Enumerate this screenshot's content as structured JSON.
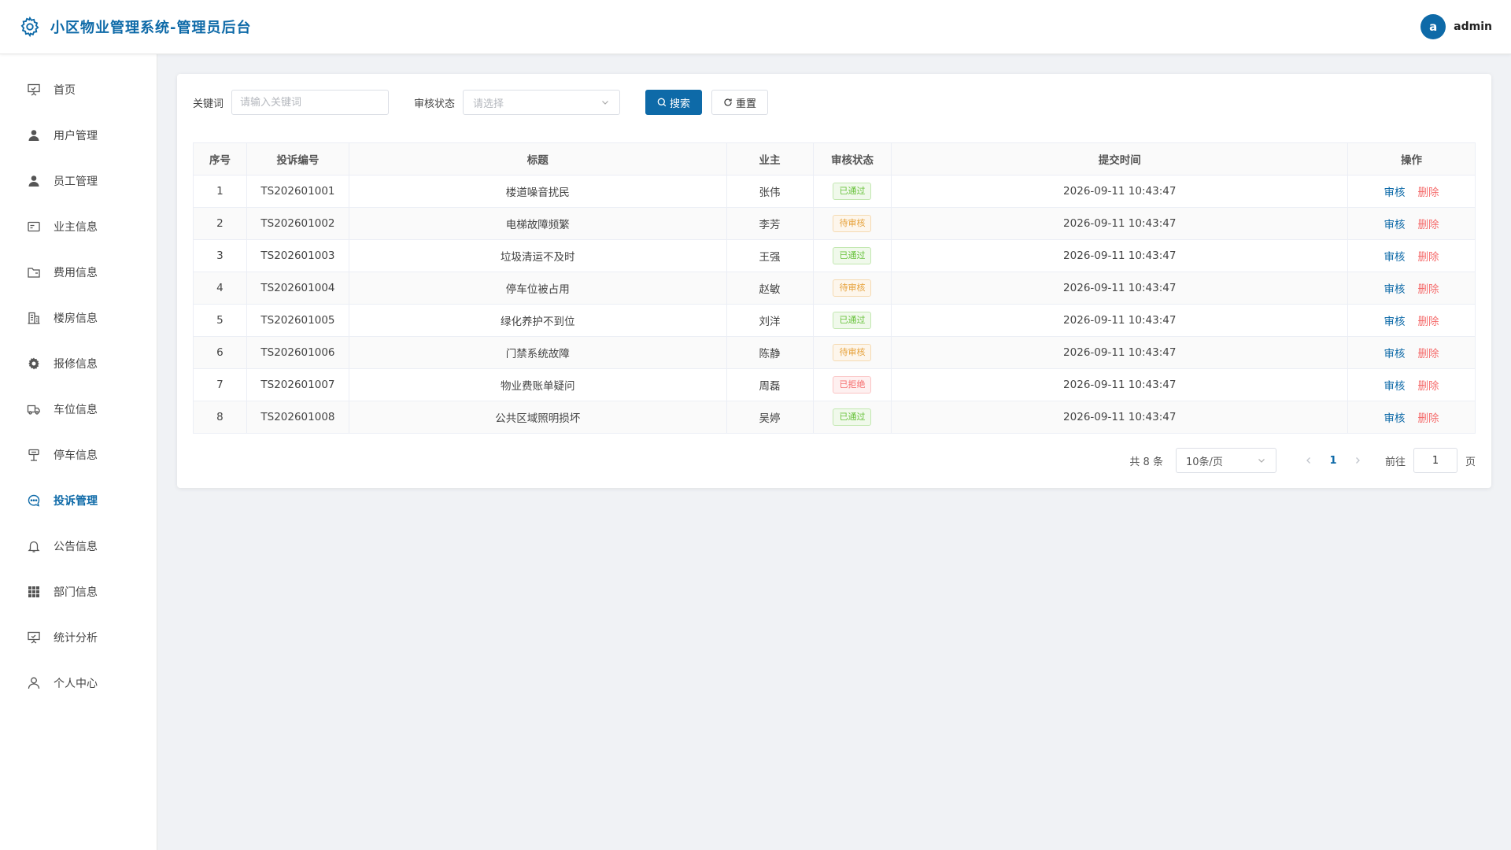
{
  "header": {
    "logo_icon": "gear-icon",
    "title": "小区物业管理系统-管理员后台",
    "avatar_letter": "a",
    "username": "admin"
  },
  "sidebar": {
    "items": [
      {
        "label": "首页",
        "icon": "presentation-icon",
        "active": false
      },
      {
        "label": "用户管理",
        "icon": "user-icon",
        "active": false
      },
      {
        "label": "员工管理",
        "icon": "user-icon",
        "active": false
      },
      {
        "label": "业主信息",
        "icon": "id-card-icon",
        "active": false
      },
      {
        "label": "费用信息",
        "icon": "folder-icon",
        "active": false
      },
      {
        "label": "楼房信息",
        "icon": "building-icon",
        "active": false
      },
      {
        "label": "报修信息",
        "icon": "gear-icon",
        "active": false
      },
      {
        "label": "车位信息",
        "icon": "truck-icon",
        "active": false
      },
      {
        "label": "停车信息",
        "icon": "parking-icon",
        "active": false
      },
      {
        "label": "投诉管理",
        "icon": "chat-icon",
        "active": true
      },
      {
        "label": "公告信息",
        "icon": "bell-icon",
        "active": false
      },
      {
        "label": "部门信息",
        "icon": "grid-icon",
        "active": false
      },
      {
        "label": "统计分析",
        "icon": "presentation-icon",
        "active": false
      },
      {
        "label": "个人中心",
        "icon": "person-outline-icon",
        "active": false
      }
    ]
  },
  "filters": {
    "keyword_label": "关键词",
    "keyword_placeholder": "请输入关键词",
    "status_label": "审核状态",
    "status_placeholder": "请选择",
    "search_label": "搜索",
    "reset_label": "重置"
  },
  "table": {
    "columns": [
      "序号",
      "投诉编号",
      "标题",
      "业主",
      "审核状态",
      "提交时间",
      "操作"
    ],
    "review_label": "审核",
    "delete_label": "删除",
    "rows": [
      {
        "no": "1",
        "code": "TS202601001",
        "title": "楼道噪音扰民",
        "owner": "张伟",
        "status": "已通过",
        "status_type": "ok",
        "time": "2026-09-11 10:43:47"
      },
      {
        "no": "2",
        "code": "TS202601002",
        "title": "电梯故障频繁",
        "owner": "李芳",
        "status": "待审核",
        "status_type": "pending",
        "time": "2026-09-11 10:43:47"
      },
      {
        "no": "3",
        "code": "TS202601003",
        "title": "垃圾清运不及时",
        "owner": "王强",
        "status": "已通过",
        "status_type": "ok",
        "time": "2026-09-11 10:43:47"
      },
      {
        "no": "4",
        "code": "TS202601004",
        "title": "停车位被占用",
        "owner": "赵敏",
        "status": "待审核",
        "status_type": "pending",
        "time": "2026-09-11 10:43:47"
      },
      {
        "no": "5",
        "code": "TS202601005",
        "title": "绿化养护不到位",
        "owner": "刘洋",
        "status": "已通过",
        "status_type": "ok",
        "time": "2026-09-11 10:43:47"
      },
      {
        "no": "6",
        "code": "TS202601006",
        "title": "门禁系统故障",
        "owner": "陈静",
        "status": "待审核",
        "status_type": "pending",
        "time": "2026-09-11 10:43:47"
      },
      {
        "no": "7",
        "code": "TS202601007",
        "title": "物业费账单疑问",
        "owner": "周磊",
        "status": "已拒绝",
        "status_type": "rejected",
        "time": "2026-09-11 10:43:47"
      },
      {
        "no": "8",
        "code": "TS202601008",
        "title": "公共区域照明损坏",
        "owner": "吴婷",
        "status": "已通过",
        "status_type": "ok",
        "time": "2026-09-11 10:43:47"
      }
    ]
  },
  "pagination": {
    "total_text": "共 8 条",
    "page_size": "10条/页",
    "current_page": "1",
    "goto_label": "前往",
    "goto_value": "1",
    "page_unit": "页"
  },
  "colors": {
    "primary": "#0e6aa8",
    "success": "#67c23a",
    "warning": "#e6a23c",
    "danger": "#f56c6c"
  }
}
